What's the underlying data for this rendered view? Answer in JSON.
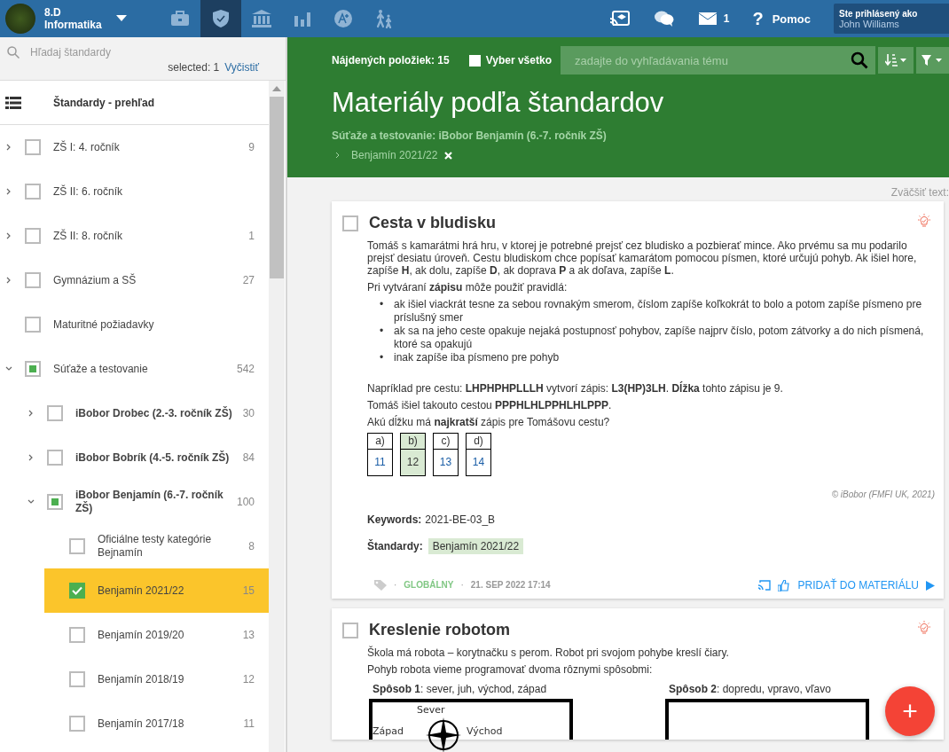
{
  "topbar": {
    "class_name": "8.D",
    "subject": "Informatika",
    "nav": [
      {
        "selected": false
      },
      {
        "selected": true
      },
      {
        "selected": false
      },
      {
        "selected": false
      },
      {
        "selected": false
      },
      {
        "selected": false
      }
    ],
    "messages_count": "1",
    "help_icon": "?",
    "help": "Pomoc",
    "login_label": "Ste prihlásený ako",
    "user": "John Williams"
  },
  "sidebar": {
    "search_placeholder": "Hľadaj štandardy",
    "selected_text": "selected: 1",
    "clear": "Vyčistiť",
    "overview": "Štandardy - prehľad",
    "tree": [
      {
        "label": "ZŠ I: 4. ročník",
        "count": "9",
        "checked": false,
        "expanded": false,
        "selected": false
      },
      {
        "label": "ZŠ II: 6. ročník",
        "checked": false,
        "expanded": false,
        "selected": false
      },
      {
        "label": "ZŠ II: 8. ročník",
        "count": "1",
        "checked": false,
        "expanded": false,
        "selected": false
      },
      {
        "label": "Gymnázium a SŠ",
        "count": "27",
        "checked": false,
        "expanded": false,
        "selected": false
      },
      {
        "label": "Maturitné požiadavky",
        "checked": false,
        "selected": false
      },
      {
        "label": "Súťaže a testovanie",
        "count": "542",
        "checked": true,
        "partial": true,
        "expanded": true,
        "selected": false,
        "children": [
          {
            "label": "iBobor Drobec (2.-3. ročník ZŠ)",
            "count": "30",
            "checked": false,
            "expanded": false,
            "selected": false
          },
          {
            "label": "iBobor Bobrík (4.-5. ročník ZŠ)",
            "count": "84",
            "checked": false,
            "expanded": false,
            "selected": false
          },
          {
            "label": "iBobor Benjamín (6.-7. ročník ZŠ)",
            "count": "100",
            "checked": true,
            "partial": true,
            "expanded": true,
            "selected": false,
            "children": [
              {
                "label": "Oficiálne testy kategórie Bejnamín",
                "count": "8",
                "checked": false,
                "selected": false
              },
              {
                "label": "Benjamín 2021/22",
                "count": "15",
                "checked": true,
                "selected": true
              },
              {
                "label": "Benjamín 2019/20",
                "count": "13",
                "checked": false,
                "selected": false
              },
              {
                "label": "Benjamín 2018/19",
                "count": "12",
                "checked": false,
                "selected": false
              },
              {
                "label": "Benjamín 2017/18",
                "count": "11",
                "checked": false,
                "selected": false
              }
            ]
          }
        ]
      }
    ]
  },
  "header": {
    "found": "Nájdených položiek: 15",
    "select_all": {
      "label": "Vyber všetko",
      "checked": false
    },
    "search_placeholder": "zadajte do vyhľadávania tému",
    "title": "Materiály podľa štandardov",
    "breadcrumb": "Súťaže a testovanie: iBobor Benjamín (6.-7. ročník ZŠ)",
    "filter_tag": "Benjamín 2021/22"
  },
  "zoom_label": "Zväčšiť text:",
  "cards": [
    {
      "title": "Cesta v bludisku",
      "checked": false,
      "blocks": [
        {
          "kind": "paragraph",
          "text": "Tomáš s kamarátmi hrá hru, v ktorej je potrebné prejsť cez bludisko a pozbierať mince. Ako prvému sa mu podarilo prejsť desiatu úroveň. Cestu bludiskom chce popísať kamarátom pomocou písmen, ktoré určujú pohyb. Ak išiel hore, zapíše **H**, ak dolu, zapíše **D**, ak doprava **P** a ak doľava, zapíše **L**."
        },
        {
          "kind": "paragraph",
          "text": "Pri vytváraní **zápisu** môže použiť pravidlá:"
        },
        {
          "kind": "list",
          "marker": "•",
          "items": [
            "ak išiel viackrát tesne za sebou rovnakým smerom, číslom zapíše koľkokrát to bolo a potom zapíše písmeno pre príslušný smer",
            "ak sa na jeho ceste opakuje nejaká postupnosť pohybov, zapíše najprv číslo, potom zátvorky a do nich písmená, ktoré sa opakujú",
            "inak zapíše iba písmeno pre pohyb"
          ]
        },
        {
          "kind": "paragraph",
          "text": "Napríklad pre cestu: **LHPHPHPLLLH** vytvorí zápis: **L3(HP)3LH**. **Dĺžka** tohto zápisu je 9."
        },
        {
          "kind": "paragraph",
          "text": "Tomáš išiel takouto cestou **PPPHLHLPPHLHLPPP**."
        },
        {
          "kind": "paragraph",
          "text": "Akú dĺžku má **najkratší** zápis pre Tomášovu cestu?"
        },
        {
          "kind": "options",
          "options": [
            {
              "label": "a)",
              "value": "11",
              "selected": false
            },
            {
              "label": "b)",
              "value": "12",
              "selected": true
            },
            {
              "label": "c)",
              "value": "13",
              "selected": false
            },
            {
              "label": "d)",
              "value": "14",
              "selected": false
            }
          ]
        },
        {
          "kind": "credit",
          "text": "© iBobor (FMFI UK, 2021)"
        }
      ],
      "meta": {
        "keywords_label": "Keywords:",
        "keywords": "2021-BE-03_B",
        "standards_label": "Štandardy:",
        "standards": [
          "Benjamín 2021/22"
        ],
        "separator": "·",
        "scope": "GLOBÁLNY",
        "date": "21. SEP 2022 17:14",
        "add": "PRIDAŤ DO MATERIÁLU"
      }
    },
    {
      "title": "Kreslenie robotom",
      "checked": false,
      "blocks": [
        {
          "kind": "paragraph",
          "text": "Škola má robota – korytnačku s perom. Robot pri svojom pohybe kreslí čiary."
        },
        {
          "kind": "paragraph",
          "text": "Pohyb robota vieme programovať dvoma rôznymi spôsobmi:"
        },
        {
          "kind": "figures",
          "figures": [
            {
              "caption": "**Spôsob 1**: sever, juh, východ, západ",
              "labels": [
                "Sever",
                "Západ",
                "Východ"
              ]
            },
            {
              "caption": "**Spôsob 2**: dopredu, vpravo, vľavo"
            }
          ]
        }
      ]
    }
  ],
  "fab": "+"
}
